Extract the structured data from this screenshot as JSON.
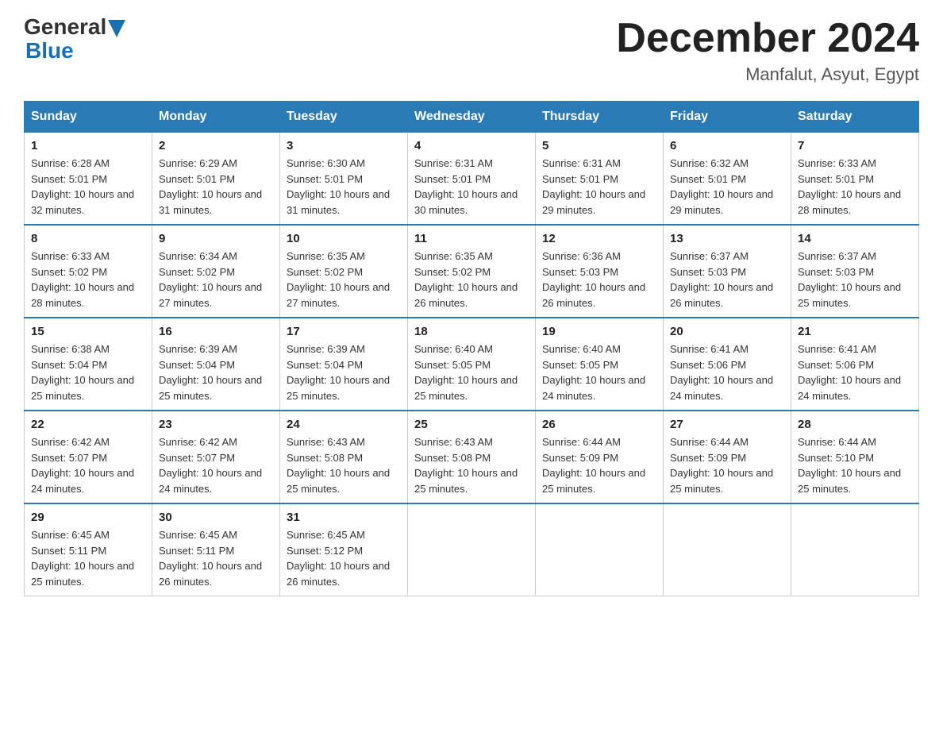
{
  "header": {
    "logo_general": "General",
    "logo_blue": "Blue",
    "month_year": "December 2024",
    "location": "Manfalut, Asyut, Egypt"
  },
  "days_of_week": [
    "Sunday",
    "Monday",
    "Tuesday",
    "Wednesday",
    "Thursday",
    "Friday",
    "Saturday"
  ],
  "weeks": [
    [
      {
        "day": "1",
        "sunrise": "6:28 AM",
        "sunset": "5:01 PM",
        "daylight": "10 hours and 32 minutes."
      },
      {
        "day": "2",
        "sunrise": "6:29 AM",
        "sunset": "5:01 PM",
        "daylight": "10 hours and 31 minutes."
      },
      {
        "day": "3",
        "sunrise": "6:30 AM",
        "sunset": "5:01 PM",
        "daylight": "10 hours and 31 minutes."
      },
      {
        "day": "4",
        "sunrise": "6:31 AM",
        "sunset": "5:01 PM",
        "daylight": "10 hours and 30 minutes."
      },
      {
        "day": "5",
        "sunrise": "6:31 AM",
        "sunset": "5:01 PM",
        "daylight": "10 hours and 29 minutes."
      },
      {
        "day": "6",
        "sunrise": "6:32 AM",
        "sunset": "5:01 PM",
        "daylight": "10 hours and 29 minutes."
      },
      {
        "day": "7",
        "sunrise": "6:33 AM",
        "sunset": "5:01 PM",
        "daylight": "10 hours and 28 minutes."
      }
    ],
    [
      {
        "day": "8",
        "sunrise": "6:33 AM",
        "sunset": "5:02 PM",
        "daylight": "10 hours and 28 minutes."
      },
      {
        "day": "9",
        "sunrise": "6:34 AM",
        "sunset": "5:02 PM",
        "daylight": "10 hours and 27 minutes."
      },
      {
        "day": "10",
        "sunrise": "6:35 AM",
        "sunset": "5:02 PM",
        "daylight": "10 hours and 27 minutes."
      },
      {
        "day": "11",
        "sunrise": "6:35 AM",
        "sunset": "5:02 PM",
        "daylight": "10 hours and 26 minutes."
      },
      {
        "day": "12",
        "sunrise": "6:36 AM",
        "sunset": "5:03 PM",
        "daylight": "10 hours and 26 minutes."
      },
      {
        "day": "13",
        "sunrise": "6:37 AM",
        "sunset": "5:03 PM",
        "daylight": "10 hours and 26 minutes."
      },
      {
        "day": "14",
        "sunrise": "6:37 AM",
        "sunset": "5:03 PM",
        "daylight": "10 hours and 25 minutes."
      }
    ],
    [
      {
        "day": "15",
        "sunrise": "6:38 AM",
        "sunset": "5:04 PM",
        "daylight": "10 hours and 25 minutes."
      },
      {
        "day": "16",
        "sunrise": "6:39 AM",
        "sunset": "5:04 PM",
        "daylight": "10 hours and 25 minutes."
      },
      {
        "day": "17",
        "sunrise": "6:39 AM",
        "sunset": "5:04 PM",
        "daylight": "10 hours and 25 minutes."
      },
      {
        "day": "18",
        "sunrise": "6:40 AM",
        "sunset": "5:05 PM",
        "daylight": "10 hours and 25 minutes."
      },
      {
        "day": "19",
        "sunrise": "6:40 AM",
        "sunset": "5:05 PM",
        "daylight": "10 hours and 24 minutes."
      },
      {
        "day": "20",
        "sunrise": "6:41 AM",
        "sunset": "5:06 PM",
        "daylight": "10 hours and 24 minutes."
      },
      {
        "day": "21",
        "sunrise": "6:41 AM",
        "sunset": "5:06 PM",
        "daylight": "10 hours and 24 minutes."
      }
    ],
    [
      {
        "day": "22",
        "sunrise": "6:42 AM",
        "sunset": "5:07 PM",
        "daylight": "10 hours and 24 minutes."
      },
      {
        "day": "23",
        "sunrise": "6:42 AM",
        "sunset": "5:07 PM",
        "daylight": "10 hours and 24 minutes."
      },
      {
        "day": "24",
        "sunrise": "6:43 AM",
        "sunset": "5:08 PM",
        "daylight": "10 hours and 25 minutes."
      },
      {
        "day": "25",
        "sunrise": "6:43 AM",
        "sunset": "5:08 PM",
        "daylight": "10 hours and 25 minutes."
      },
      {
        "day": "26",
        "sunrise": "6:44 AM",
        "sunset": "5:09 PM",
        "daylight": "10 hours and 25 minutes."
      },
      {
        "day": "27",
        "sunrise": "6:44 AM",
        "sunset": "5:09 PM",
        "daylight": "10 hours and 25 minutes."
      },
      {
        "day": "28",
        "sunrise": "6:44 AM",
        "sunset": "5:10 PM",
        "daylight": "10 hours and 25 minutes."
      }
    ],
    [
      {
        "day": "29",
        "sunrise": "6:45 AM",
        "sunset": "5:11 PM",
        "daylight": "10 hours and 25 minutes."
      },
      {
        "day": "30",
        "sunrise": "6:45 AM",
        "sunset": "5:11 PM",
        "daylight": "10 hours and 26 minutes."
      },
      {
        "day": "31",
        "sunrise": "6:45 AM",
        "sunset": "5:12 PM",
        "daylight": "10 hours and 26 minutes."
      },
      null,
      null,
      null,
      null
    ]
  ],
  "labels": {
    "sunrise": "Sunrise:",
    "sunset": "Sunset:",
    "daylight": "Daylight:"
  }
}
